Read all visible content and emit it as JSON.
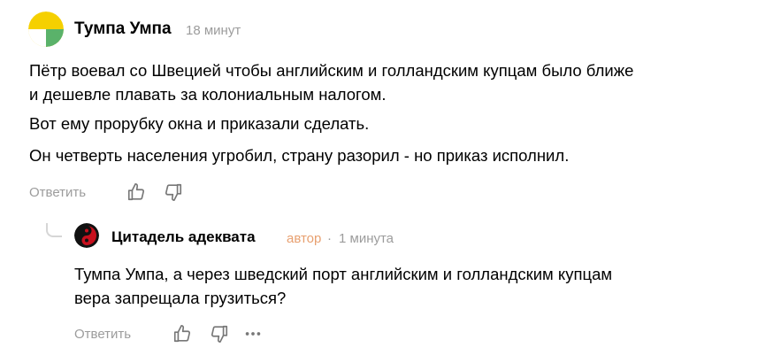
{
  "comment": {
    "author": "Тумпа Умпа",
    "time": "18 минут",
    "paragraphs": [
      "Пётр воевал со Швецией чтобы английским и голландским купцам было ближе",
      "и дешевле плавать за колониальным налогом.",
      "Вот ему прорубку окна и приказали сделать.",
      "Он четверть населения угробил, страну разорил - но приказ исполнил."
    ],
    "actions": {
      "reply_label": "Ответить",
      "like_icon": "thumbs-up-icon",
      "dislike_icon": "thumbs-down-icon"
    }
  },
  "reply": {
    "author": "Цитадель адеквата",
    "badge": "автор",
    "separator": "·",
    "time": "1 минута",
    "lines": [
      "Тумпа Умпа, а через шведский порт английским и голландским купцам",
      "вера запрещала грузиться?"
    ],
    "actions": {
      "reply_label": "Ответить",
      "like_icon": "thumbs-up-icon",
      "dislike_icon": "thumbs-down-icon",
      "more_icon": "more-dots-icon"
    }
  },
  "colors": {
    "muted_text": "#9c9c9c",
    "author_badge": "#e8a070",
    "avatar_yellow": "#f5d000",
    "avatar_green": "#5ab26a",
    "avatar_red": "#c8101e"
  }
}
